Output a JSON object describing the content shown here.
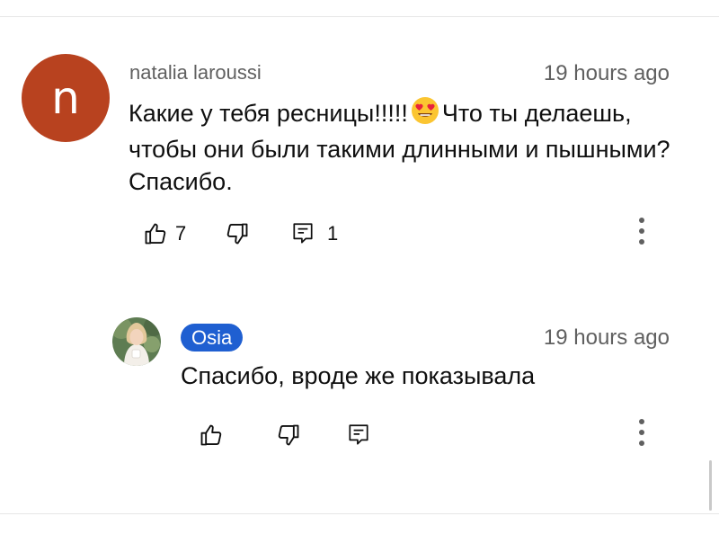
{
  "comment": {
    "avatar_letter": "n",
    "author": "natalia laroussi",
    "timestamp": "19 hours ago",
    "text_before_emoji": "Какие у тебя ресницы!!!!!",
    "emoji_icon": "smiling-face-with-heart-eyes",
    "text_after_emoji": "Что ты делаешь, чтобы они были такими длинными и пышными? Спасибо.",
    "likes": "7",
    "replies": "1"
  },
  "reply": {
    "author": "Osia",
    "timestamp": "19 hours ago",
    "text": "Спасибо, вроде же показывала"
  },
  "colors": {
    "avatar_bg": "#b8421f",
    "author_badge": "#1f5fd1",
    "secondary_text": "#606060"
  }
}
